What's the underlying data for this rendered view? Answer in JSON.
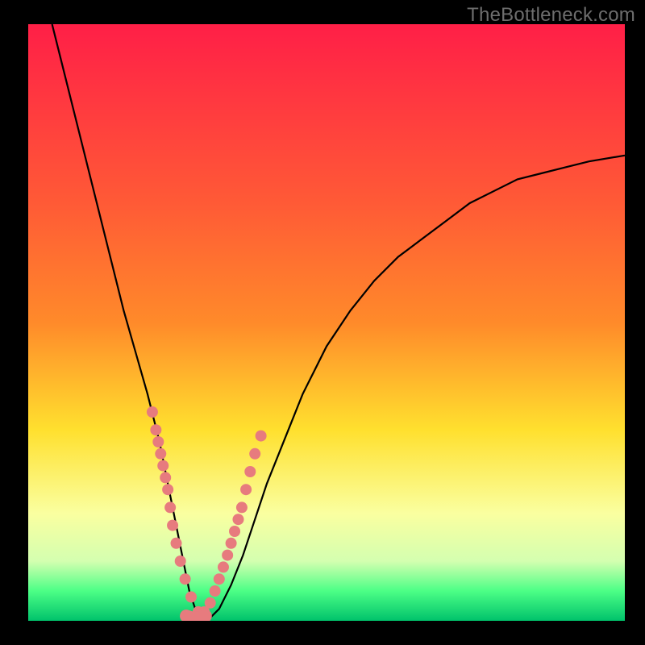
{
  "watermark": "TheBottleneck.com",
  "colors": {
    "gradient_top": "#ff1f47",
    "gradient_mid1": "#ff8a2a",
    "gradient_mid2": "#ffe02e",
    "gradient_mid3": "#faffa0",
    "gradient_bottom1": "#4cff86",
    "gradient_bottom2": "#00c26b",
    "curve": "#000000",
    "marker": "#e77b7e"
  },
  "chart_data": {
    "type": "line",
    "title": "",
    "xlabel": "",
    "ylabel": "",
    "xlim": [
      0,
      100
    ],
    "ylim": [
      0,
      100
    ],
    "series": [
      {
        "name": "bottleneck-curve",
        "x": [
          4,
          6,
          8,
          10,
          12,
          14,
          16,
          18,
          20,
          21,
          22,
          23,
          24,
          25,
          26,
          27,
          28,
          29,
          30,
          32,
          34,
          36,
          38,
          40,
          42,
          44,
          46,
          48,
          50,
          54,
          58,
          62,
          66,
          70,
          74,
          78,
          82,
          86,
          90,
          94,
          100
        ],
        "values": [
          100,
          92,
          84,
          76,
          68,
          60,
          52,
          45,
          38,
          34,
          30,
          25,
          20,
          15,
          10,
          5,
          2,
          0,
          0,
          2,
          6,
          11,
          17,
          23,
          28,
          33,
          38,
          42,
          46,
          52,
          57,
          61,
          64,
          67,
          70,
          72,
          74,
          75,
          76,
          77,
          78
        ]
      }
    ],
    "markers": {
      "left_cluster": {
        "x": [
          20.8,
          21.4,
          21.8,
          22.2,
          22.6,
          23.0,
          23.4,
          23.8,
          24.2,
          24.8,
          25.5,
          26.3,
          27.3,
          28.5
        ],
        "y": [
          35,
          32,
          30,
          28,
          26,
          24,
          22,
          19,
          16,
          13,
          10,
          7,
          4,
          1.5
        ]
      },
      "right_cluster": {
        "x": [
          29.5,
          30.5,
          31.3,
          32.0,
          32.7,
          33.4,
          34.0,
          34.6,
          35.2,
          35.8,
          36.5,
          37.2,
          38.0,
          39.0
        ],
        "y": [
          1.5,
          3,
          5,
          7,
          9,
          11,
          13,
          15,
          17,
          19,
          22,
          25,
          28,
          31
        ]
      },
      "bottom_blob": {
        "x": [
          26.5,
          27.3,
          28.1,
          28.9,
          29.7
        ],
        "y": [
          0.8,
          0.5,
          0.5,
          0.5,
          0.8
        ]
      }
    }
  }
}
